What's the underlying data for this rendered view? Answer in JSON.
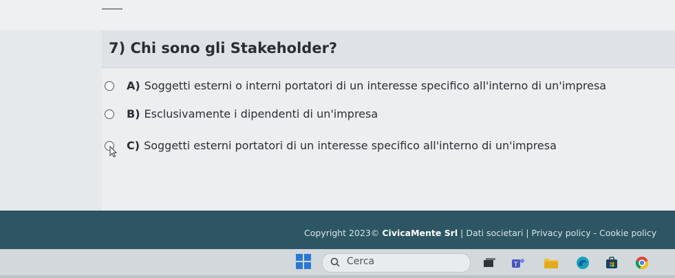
{
  "question": {
    "title": "7) Chi sono gli Stakeholder?"
  },
  "options": [
    {
      "letter": "A)",
      "text": "Soggetti esterni o interni portatori di un interesse specifico all'interno di un'impresa"
    },
    {
      "letter": "B)",
      "text": "Esclusivamente i dipendenti di un'impresa"
    },
    {
      "letter": "C)",
      "text": "Soggetti esterni portatori di un interesse specifico all'interno di un'impresa"
    }
  ],
  "footer": {
    "copyright": "Copyright 2023©",
    "company": "CivicaMente Srl",
    "links": "| Dati societari | Privacy policy - Cookie policy"
  },
  "taskbar": {
    "search_placeholder": "Cerca",
    "icons": [
      "windows-start-icon",
      "search-icon",
      "task-view-icon",
      "teams-icon",
      "file-explorer-icon",
      "edge-icon",
      "store-icon",
      "chrome-icon"
    ]
  },
  "colors": {
    "footer_bg": "#2d5563",
    "windows_blue": "#2a78d6"
  }
}
